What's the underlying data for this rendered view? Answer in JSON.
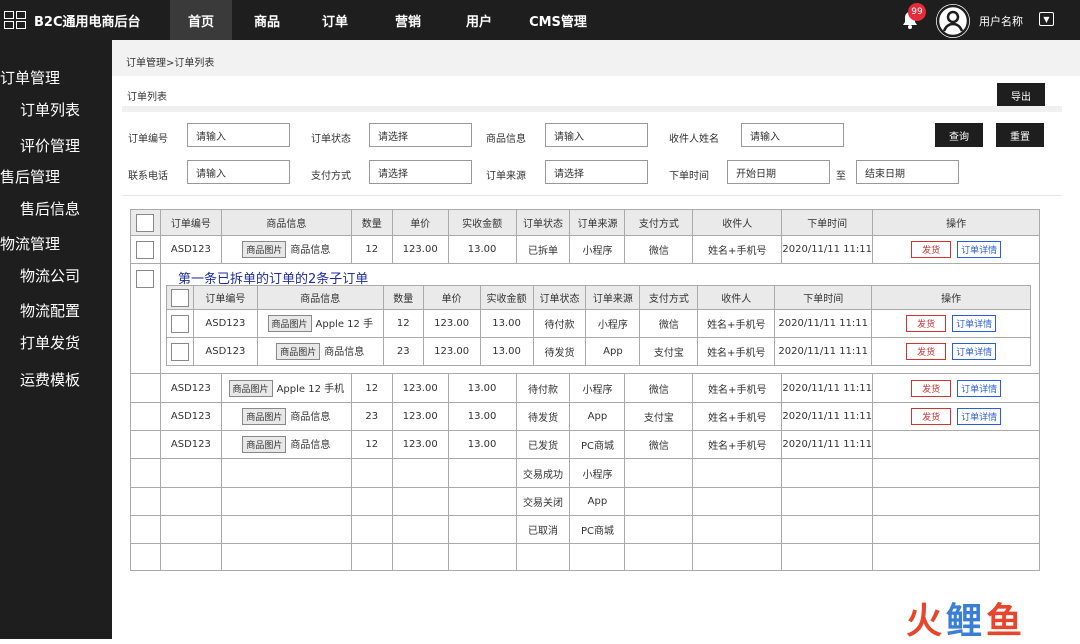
{
  "app": {
    "title": "B2C通用电商后台"
  },
  "nav": [
    "首页",
    "商品",
    "订单",
    "营销",
    "用户",
    "CMS管理"
  ],
  "user": {
    "badge": "99",
    "name": "用户名称"
  },
  "sidebar": [
    "订单管理",
    "订单列表",
    "评价管理",
    "售后管理",
    "售后信息",
    "物流管理",
    "物流公司",
    "物流配置",
    "打单发货",
    "运费模板"
  ],
  "breadcrumb": "订单管理>订单列表",
  "page_title": "订单列表",
  "export_label": "导出",
  "filters": {
    "order_no": {
      "label": "订单编号",
      "placeholder": "请输入"
    },
    "order_status": {
      "label": "订单状态",
      "placeholder": "请选择"
    },
    "product_info": {
      "label": "商品信息",
      "placeholder": "请输入"
    },
    "receiver": {
      "label": "收件人姓名",
      "placeholder": "请输入"
    },
    "phone": {
      "label": "联系电话",
      "placeholder": "请输入"
    },
    "pay_method": {
      "label": "支付方式",
      "placeholder": "请选择"
    },
    "source": {
      "label": "订单来源",
      "placeholder": "请选择"
    },
    "order_time": {
      "label": "下单时间",
      "start": "开始日期",
      "to": "至",
      "end": "结束日期"
    },
    "query_label": "查询",
    "reset_label": "重置"
  },
  "table": {
    "headers": [
      "订单编号",
      "商品信息",
      "数量",
      "单价",
      "实收金额",
      "订单状态",
      "订单来源",
      "支付方式",
      "收件人",
      "下单时间",
      "操作"
    ],
    "img_label": "商品图片",
    "ship_label": "发货",
    "detail_label": "订单详情",
    "rows": [
      {
        "id": "ASD123",
        "product": "商品信息",
        "qty": "12",
        "price": "123.00",
        "paid": "13.00",
        "status": "已拆单",
        "source": "小程序",
        "pay": "微信",
        "receiver": "姓名+手机号",
        "time": "2020/11/11 11:11",
        "actions": true
      },
      {
        "id": "ASD123",
        "product": "Apple 12 手机",
        "qty": "12",
        "price": "123.00",
        "paid": "13.00",
        "status": "待付款",
        "source": "小程序",
        "pay": "微信",
        "receiver": "姓名+手机号",
        "time": "2020/11/11 11:11",
        "actions": true
      },
      {
        "id": "ASD123",
        "product": "商品信息",
        "qty": "23",
        "price": "123.00",
        "paid": "13.00",
        "status": "待发货",
        "source": "App",
        "pay": "支付宝",
        "receiver": "姓名+手机号",
        "time": "2020/11/11 11:11",
        "actions": true
      },
      {
        "id": "ASD123",
        "product": "商品信息",
        "qty": "12",
        "price": "123.00",
        "paid": "13.00",
        "status": "已发货",
        "source": "PC商城",
        "pay": "微信",
        "receiver": "姓名+手机号",
        "time": "2020/11/11 11:11",
        "actions": false
      },
      {
        "id": "",
        "product": "",
        "qty": "",
        "price": "",
        "paid": "",
        "status": "交易成功",
        "source": "小程序",
        "pay": "",
        "receiver": "",
        "time": "",
        "actions": false
      },
      {
        "id": "",
        "product": "",
        "qty": "",
        "price": "",
        "paid": "",
        "status": "交易关闭",
        "source": "App",
        "pay": "",
        "receiver": "",
        "time": "",
        "actions": false
      },
      {
        "id": "",
        "product": "",
        "qty": "",
        "price": "",
        "paid": "",
        "status": "已取消",
        "source": "PC商城",
        "pay": "",
        "receiver": "",
        "time": "",
        "actions": false
      },
      {
        "id": "",
        "product": "",
        "qty": "",
        "price": "",
        "paid": "",
        "status": "",
        "source": "",
        "pay": "",
        "receiver": "",
        "time": "",
        "actions": false
      }
    ],
    "sub_note": "第一条已拆单的订单的2条子订单",
    "sub_rows": [
      {
        "id": "ASD123",
        "product": "Apple 12 手",
        "qty": "12",
        "price": "123.00",
        "paid": "13.00",
        "status": "待付款",
        "source": "小程序",
        "pay": "微信",
        "receiver": "姓名+手机号",
        "time": "2020/11/11 11:11"
      },
      {
        "id": "ASD123",
        "product": "商品信息",
        "qty": "23",
        "price": "123.00",
        "paid": "13.00",
        "status": "待发货",
        "source": "App",
        "pay": "支付宝",
        "receiver": "姓名+手机号",
        "time": "2020/11/11 11:11"
      }
    ]
  },
  "watermark": {
    "a": "火",
    "b": "鲤",
    "c": "鱼"
  }
}
